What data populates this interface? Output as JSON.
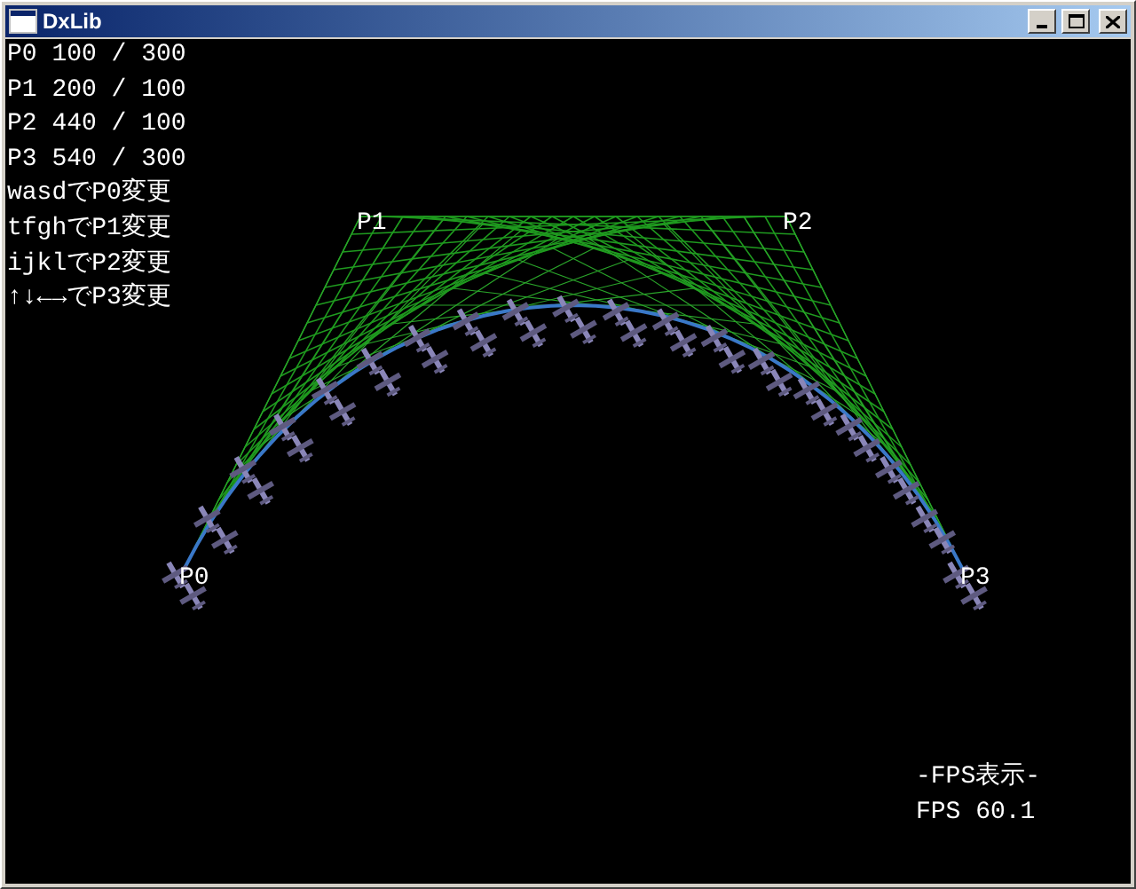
{
  "window": {
    "title": "DxLib"
  },
  "info_lines": [
    "P0 100 / 300",
    "P1 200 / 100",
    "P2 440 / 100",
    "P3 540 / 300",
    "wasdでP0変更",
    "tfghでP1変更",
    "ijklでP2変更",
    "↑↓←→でP3変更"
  ],
  "point_labels": [
    "P0",
    "P1",
    "P2",
    "P3"
  ],
  "fps": {
    "heading": "-FPS表示-",
    "reading": "FPS 60.1"
  }
}
